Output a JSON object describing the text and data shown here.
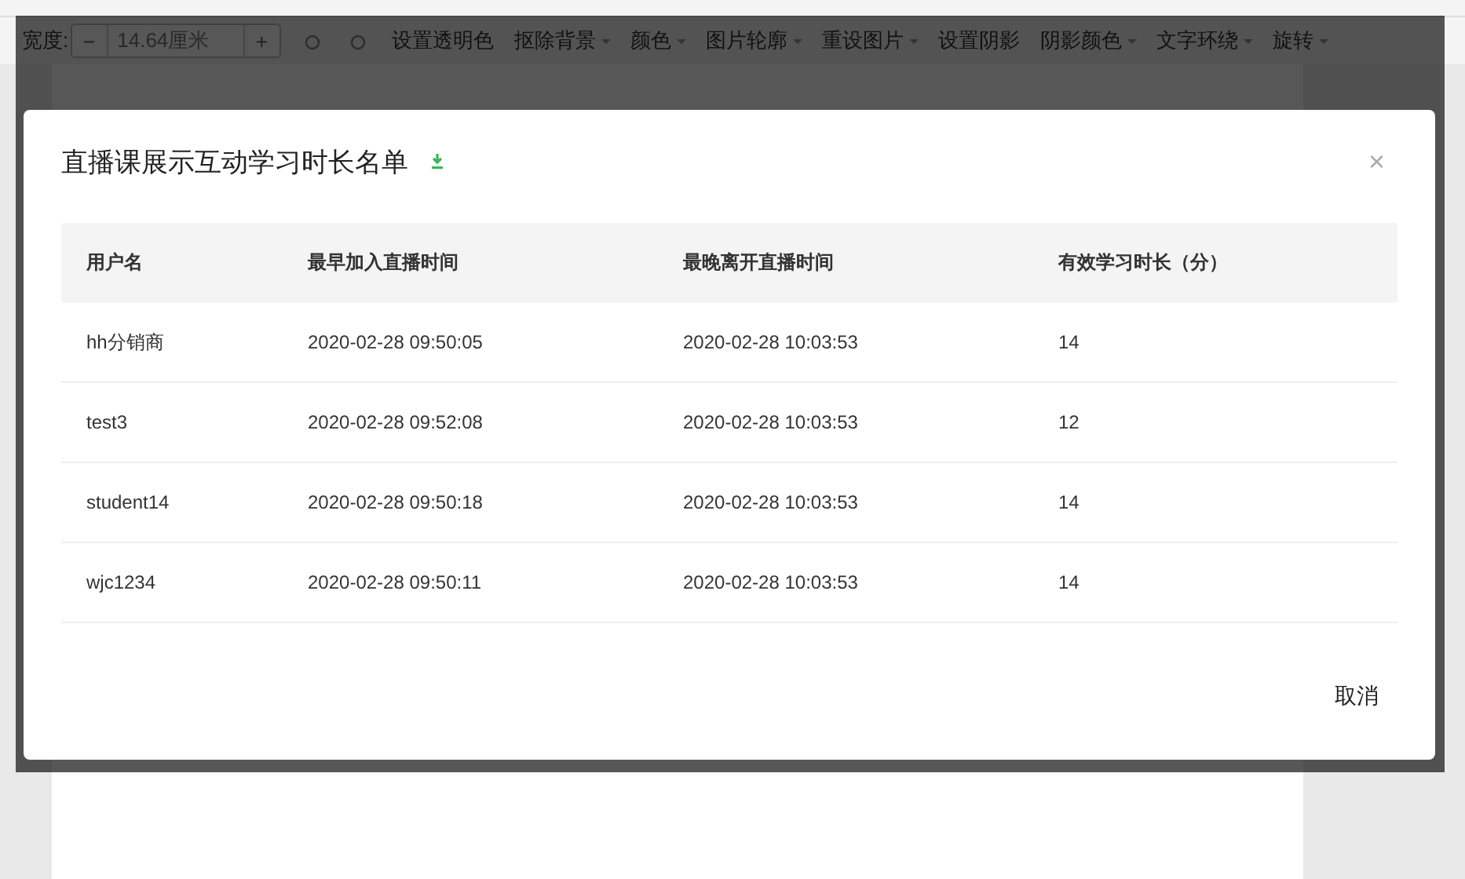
{
  "toolbar": {
    "width_label": "宽度:",
    "width_value": "14.64厘米",
    "minus": "−",
    "plus": "+",
    "items": [
      {
        "label": "设置透明色",
        "dropdown": false
      },
      {
        "label": "抠除背景",
        "dropdown": true
      },
      {
        "label": "颜色",
        "dropdown": true
      },
      {
        "label": "图片轮廓",
        "dropdown": true
      },
      {
        "label": "重设图片",
        "dropdown": true
      },
      {
        "label": "设置阴影",
        "dropdown": false
      },
      {
        "label": "阴影颜色",
        "dropdown": true
      },
      {
        "label": "文字环绕",
        "dropdown": true
      },
      {
        "label": "旋转",
        "dropdown": true
      }
    ]
  },
  "dialog": {
    "title": "直播课展示互动学习时长名单",
    "close": "×",
    "table": {
      "columns": [
        "用户名",
        "最早加入直播时间",
        "最晚离开直播时间",
        "有效学习时长（分）"
      ],
      "rows": [
        [
          "hh分销商",
          "2020-02-28 09:50:05",
          "2020-02-28 10:03:53",
          "14"
        ],
        [
          "test3",
          "2020-02-28 09:52:08",
          "2020-02-28 10:03:53",
          "12"
        ],
        [
          "student14",
          "2020-02-28 09:50:18",
          "2020-02-28 10:03:53",
          "14"
        ],
        [
          "wjc1234",
          "2020-02-28 09:50:11",
          "2020-02-28 10:03:53",
          "14"
        ]
      ]
    },
    "cancel": "取消"
  }
}
